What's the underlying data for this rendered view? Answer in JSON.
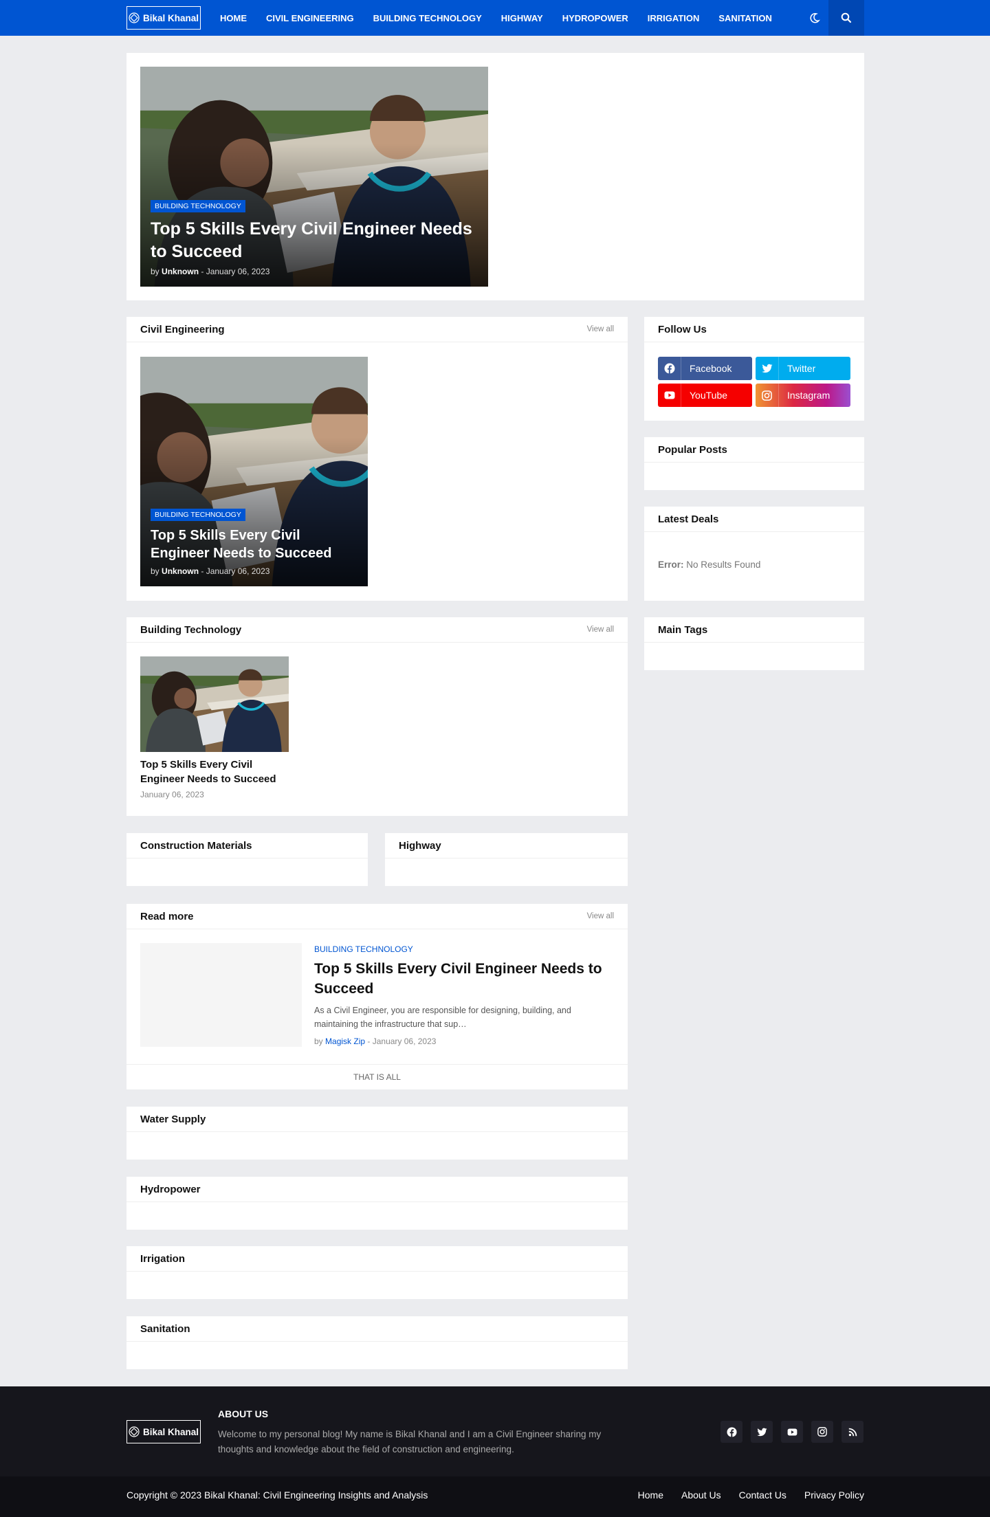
{
  "header": {
    "logo_text": "Bikal Khanal",
    "nav": [
      "HOME",
      "CIVIL ENGINEERING",
      "BUILDING TECHNOLOGY",
      "HIGHWAY",
      "HYDROPOWER",
      "IRRIGATION",
      "SANITATION"
    ]
  },
  "featured": {
    "category": "BUILDING TECHNOLOGY",
    "title": "Top 5 Skills Every Civil Engineer Needs to Succeed",
    "by": "by",
    "author": "Unknown",
    "date": "January 06, 2023"
  },
  "civil": {
    "title": "Civil Engineering",
    "view_all": "View all",
    "post": {
      "category": "BUILDING TECHNOLOGY",
      "title": "Top 5 Skills Every Civil Engineer Needs to Succeed",
      "by": "by",
      "author": "Unknown",
      "date": "January 06, 2023"
    }
  },
  "building": {
    "title": "Building Technology",
    "view_all": "View all",
    "post": {
      "title": "Top 5 Skills Every Civil Engineer Needs to Succeed",
      "date": "January 06, 2023"
    }
  },
  "construction": {
    "title": "Construction Materials"
  },
  "highway": {
    "title": "Highway"
  },
  "read_more": {
    "title": "Read more",
    "view_all": "View all",
    "post": {
      "category": "BUILDING TECHNOLOGY",
      "title": "Top 5 Skills Every Civil Engineer Needs to Succeed",
      "excerpt": "As a Civil Engineer, you are responsible for designing, building, and maintaining the infrastructure that sup…",
      "by": "by",
      "author": "Magisk Zip",
      "date": "January 06, 2023"
    },
    "end_text": "THAT IS ALL"
  },
  "water_supply": {
    "title": "Water Supply"
  },
  "hydropower": {
    "title": "Hydropower"
  },
  "irrigation": {
    "title": "Irrigation"
  },
  "sanitation": {
    "title": "Sanitation"
  },
  "sidebar": {
    "follow": {
      "title": "Follow Us",
      "buttons": [
        {
          "label": "Facebook",
          "icon": "facebook-icon",
          "color": "#3b5999"
        },
        {
          "label": "Twitter",
          "icon": "twitter-icon",
          "color": "#00acee"
        },
        {
          "label": "YouTube",
          "icon": "youtube-icon",
          "color": "#f50000"
        },
        {
          "label": "Instagram",
          "icon": "instagram-icon",
          "color": "#c13584"
        }
      ]
    },
    "popular": {
      "title": "Popular Posts"
    },
    "deals": {
      "title": "Latest Deals",
      "error_label": "Error:",
      "error_text": "No Results Found"
    },
    "tags": {
      "title": "Main Tags"
    }
  },
  "footer": {
    "logo_text": "Bikal Khanal",
    "about_title": "ABOUT US",
    "about_text": "Welcome to my personal blog! My name is Bikal Khanal and I am a Civil Engineer sharing my thoughts and knowledge about the field of construction and engineering.",
    "social_icons": [
      "facebook-icon",
      "twitter-icon",
      "youtube-icon",
      "instagram-icon",
      "rss-icon"
    ],
    "copyright": "Copyright © 2023 Bikal Khanal: Civil Engineering Insights and Analysis",
    "links": [
      "Home",
      "About Us",
      "Contact Us",
      "Privacy Policy"
    ]
  },
  "colors": {
    "accent": "#0055d2",
    "background": "#ebecef",
    "footer": "#16161c",
    "facebook": "#3b5999",
    "twitter": "#00acee",
    "youtube": "#f50000",
    "instagram": "#c13584"
  }
}
